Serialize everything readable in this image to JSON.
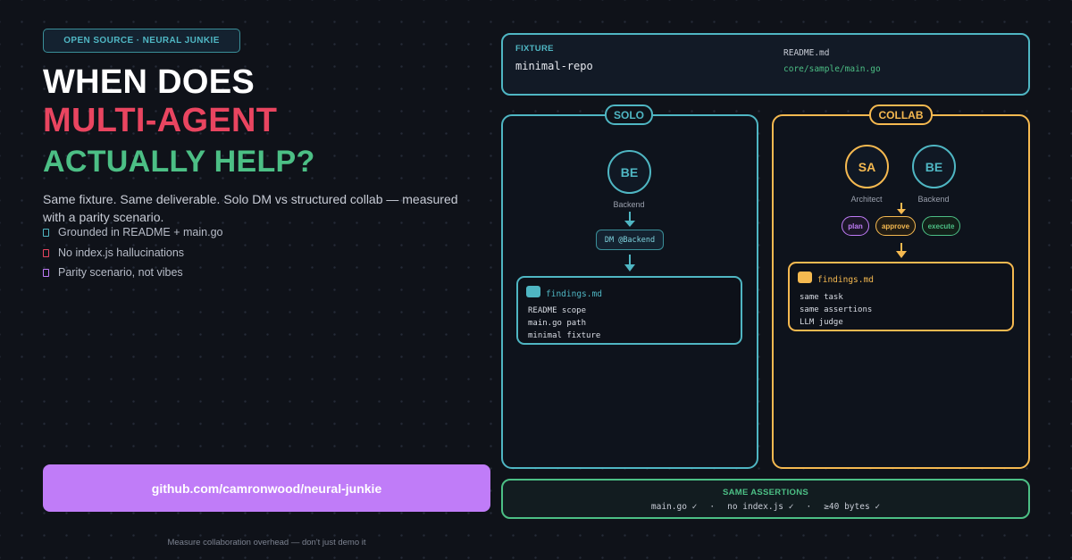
{
  "badge": "OPEN SOURCE · NEURAL JUNKIE",
  "headline": {
    "line1": "WHEN DOES",
    "line2": "MULTI-AGENT",
    "line3": "ACTUALLY HELP?"
  },
  "subtitle": "Same fixture. Same deliverable. Solo DM vs structured collab — measured with a parity scenario.",
  "bullets": [
    {
      "text": "Grounded in README + main.go",
      "color": "#4fb6c3"
    },
    {
      "text": "No index.js hallucinations",
      "color": "#e94560"
    },
    {
      "text": "Parity scenario, not vibes",
      "color": "#c07cf8"
    }
  ],
  "cta": "github.com/camronwood/neural-junkie",
  "footer": "Measure collaboration overhead — don't just demo it",
  "fixture": {
    "label": "FIXTURE",
    "name": "minimal-repo",
    "files": [
      "README.md",
      "core/sample/main.go"
    ]
  },
  "solo": {
    "tag": "SOLO",
    "agent": {
      "initials": "BE",
      "caption": "Backend"
    },
    "message": "DM @Backend",
    "findings": {
      "title": "findings.md",
      "lines": [
        "README scope",
        "main.go path",
        "minimal fixture"
      ]
    }
  },
  "collab": {
    "tag": "COLLAB",
    "agents": [
      {
        "initials": "SA",
        "caption": "Architect"
      },
      {
        "initials": "BE",
        "caption": "Backend"
      }
    ],
    "steps": [
      "plan",
      "approve",
      "execute"
    ],
    "findings": {
      "title": "findings.md",
      "lines": [
        "same task",
        "same assertions",
        "LLM judge"
      ]
    }
  },
  "assertions": {
    "label": "SAME ASSERTIONS",
    "items": [
      "main.go ✓",
      "·",
      "no index.js ✓",
      "·",
      "≥40 bytes ✓"
    ]
  },
  "colors": {
    "cyan": "#4fb6c3",
    "red": "#e94560",
    "green": "#4cbf85",
    "orange": "#f5b950",
    "purple": "#c07cf8"
  }
}
